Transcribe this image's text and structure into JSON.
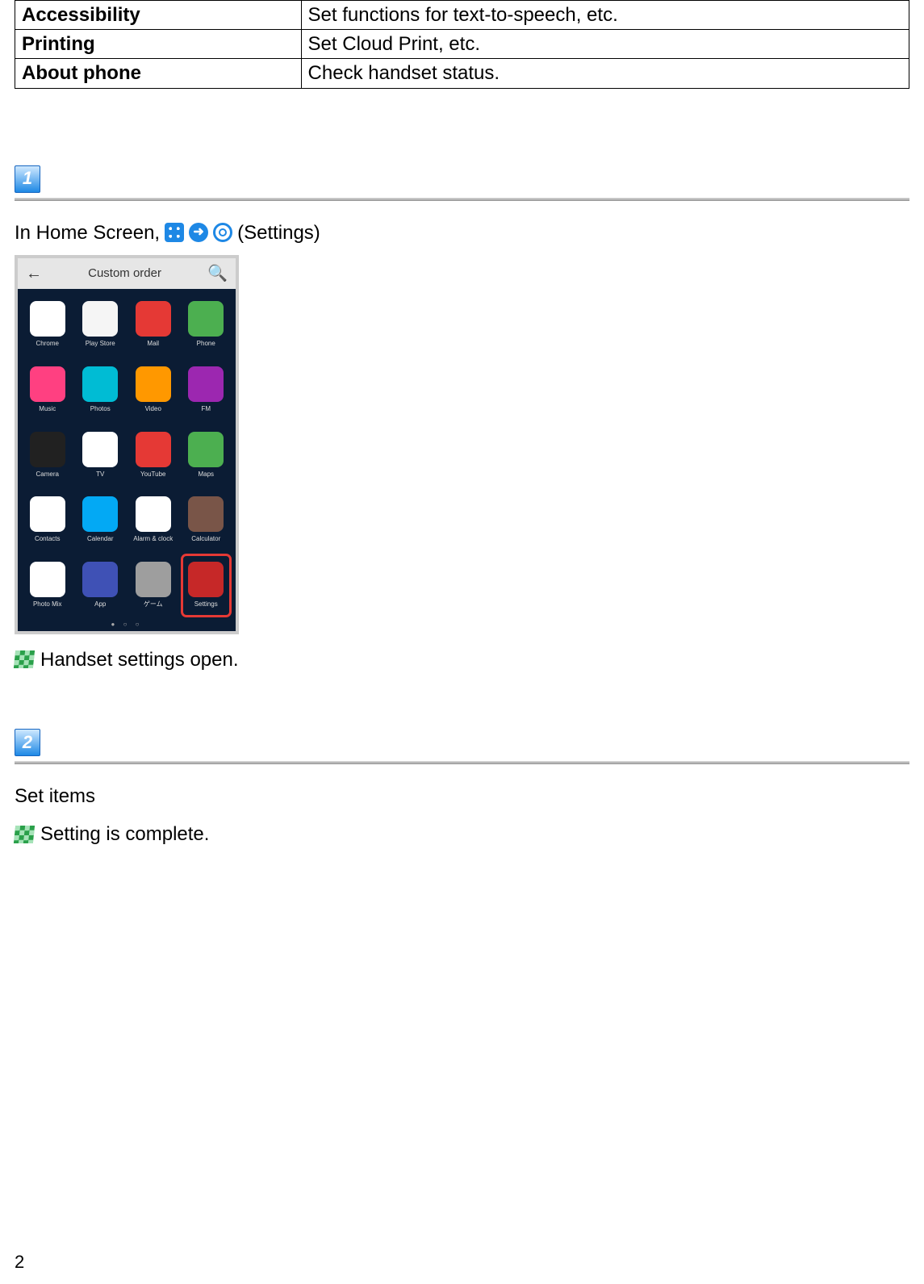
{
  "table_rows": [
    {
      "label": "Accessibility",
      "desc": "Set functions for text-to-speech, etc."
    },
    {
      "label": "Printing",
      "desc": "Set Cloud Print, etc."
    },
    {
      "label": "About phone",
      "desc": "Check handset status."
    }
  ],
  "step1": {
    "badge": "1",
    "instr_prefix": "In Home Screen,",
    "instr_suffix": "(Settings)",
    "result": "Handset settings open."
  },
  "screenshot": {
    "topbar_title": "Custom order",
    "apps": [
      {
        "label": "Chrome",
        "color": "#fff"
      },
      {
        "label": "Play Store",
        "color": "#f5f5f5"
      },
      {
        "label": "Mail",
        "color": "#e53935"
      },
      {
        "label": "Phone",
        "color": "#4caf50"
      },
      {
        "label": "Music",
        "color": "#ff4081"
      },
      {
        "label": "Photos",
        "color": "#00bcd4"
      },
      {
        "label": "Video",
        "color": "#ff9800"
      },
      {
        "label": "FM",
        "color": "#9c27b0"
      },
      {
        "label": "Camera",
        "color": "#212121"
      },
      {
        "label": "TV",
        "color": "#fff"
      },
      {
        "label": "YouTube",
        "color": "#e53935"
      },
      {
        "label": "Maps",
        "color": "#4caf50"
      },
      {
        "label": "Contacts",
        "color": "#fff"
      },
      {
        "label": "Calendar",
        "color": "#03a9f4"
      },
      {
        "label": "Alarm & clock",
        "color": "#fff"
      },
      {
        "label": "Calculator",
        "color": "#795548"
      },
      {
        "label": "Photo Mix",
        "color": "#fff"
      },
      {
        "label": "App",
        "color": "#3f51b5"
      },
      {
        "label": "ゲーム",
        "color": "#9e9e9e"
      },
      {
        "label": "Settings",
        "color": "#c62828",
        "highlight": true
      }
    ]
  },
  "step2": {
    "badge": "2",
    "instr": "Set items",
    "result": "Setting is complete."
  },
  "page_number": "2"
}
